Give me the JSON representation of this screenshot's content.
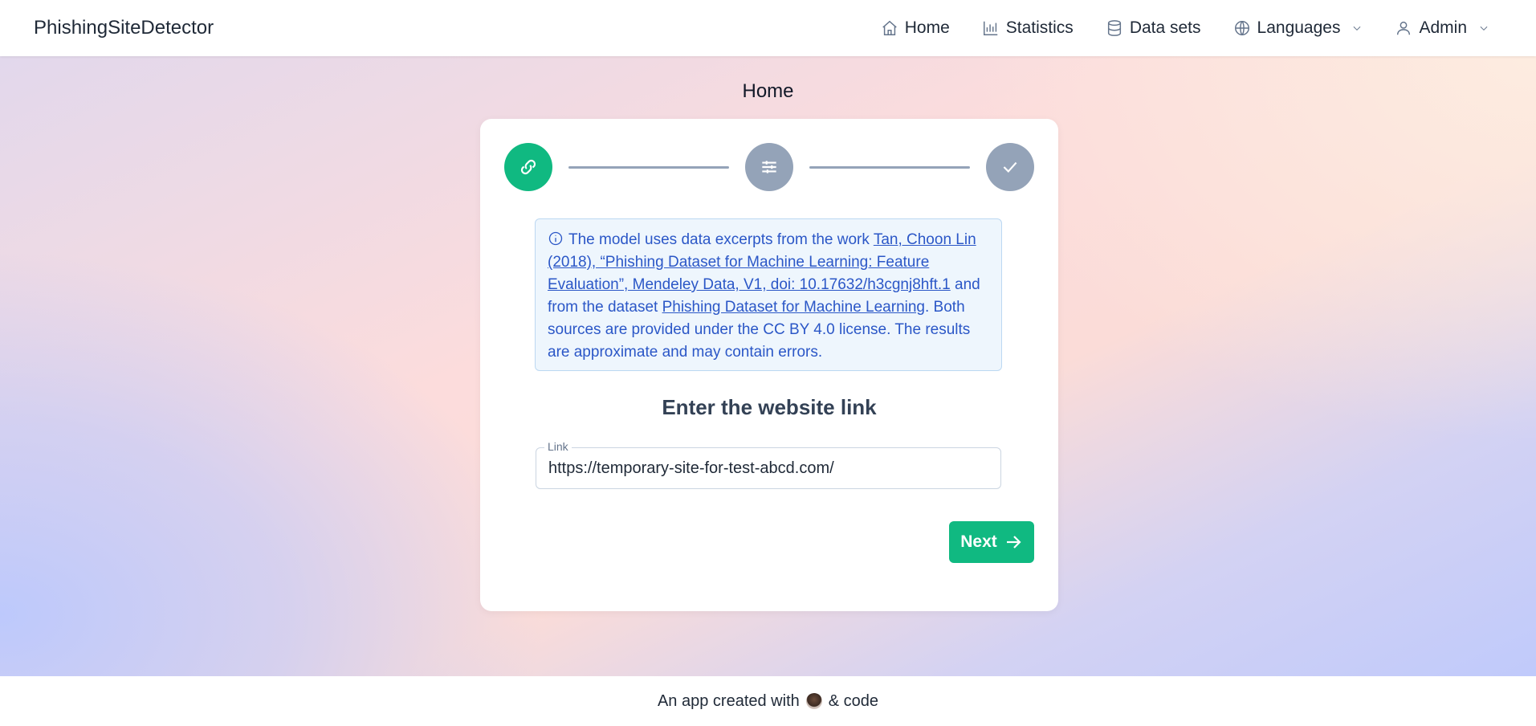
{
  "brand": "PhishingSiteDetector",
  "nav": {
    "home": "Home",
    "statistics": "Statistics",
    "datasets": "Data sets",
    "languages": "Languages",
    "admin": "Admin"
  },
  "page_title": "Home",
  "info": {
    "text_before": "The model uses data excerpts from the work ",
    "link1": "Tan, Choon Lin (2018), “Phishing Dataset for Machine Learning: Feature Evaluation”, Mendeley Data, V1, doi: 10.17632/h3cgnj8hft.1",
    "text_middle": " and from the dataset ",
    "link2": "Phishing Dataset for Machine Learning",
    "text_after": ". Both sources are provided under the CC BY 4.0 license. The results are approximate and may contain errors."
  },
  "form": {
    "title": "Enter the website link",
    "link_label": "Link",
    "link_value": "https://temporary-site-for-test-abcd.com/",
    "next_label": "Next"
  },
  "footer": {
    "before": "An app created with",
    "after": "& code"
  },
  "colors": {
    "accent": "#10b981",
    "inactive_step": "#94a3b8",
    "info_text": "#2b57c7",
    "info_bg": "#eef6fd"
  },
  "icons": {
    "step1": "link-icon",
    "step2": "sliders-icon",
    "step3": "check-icon"
  }
}
